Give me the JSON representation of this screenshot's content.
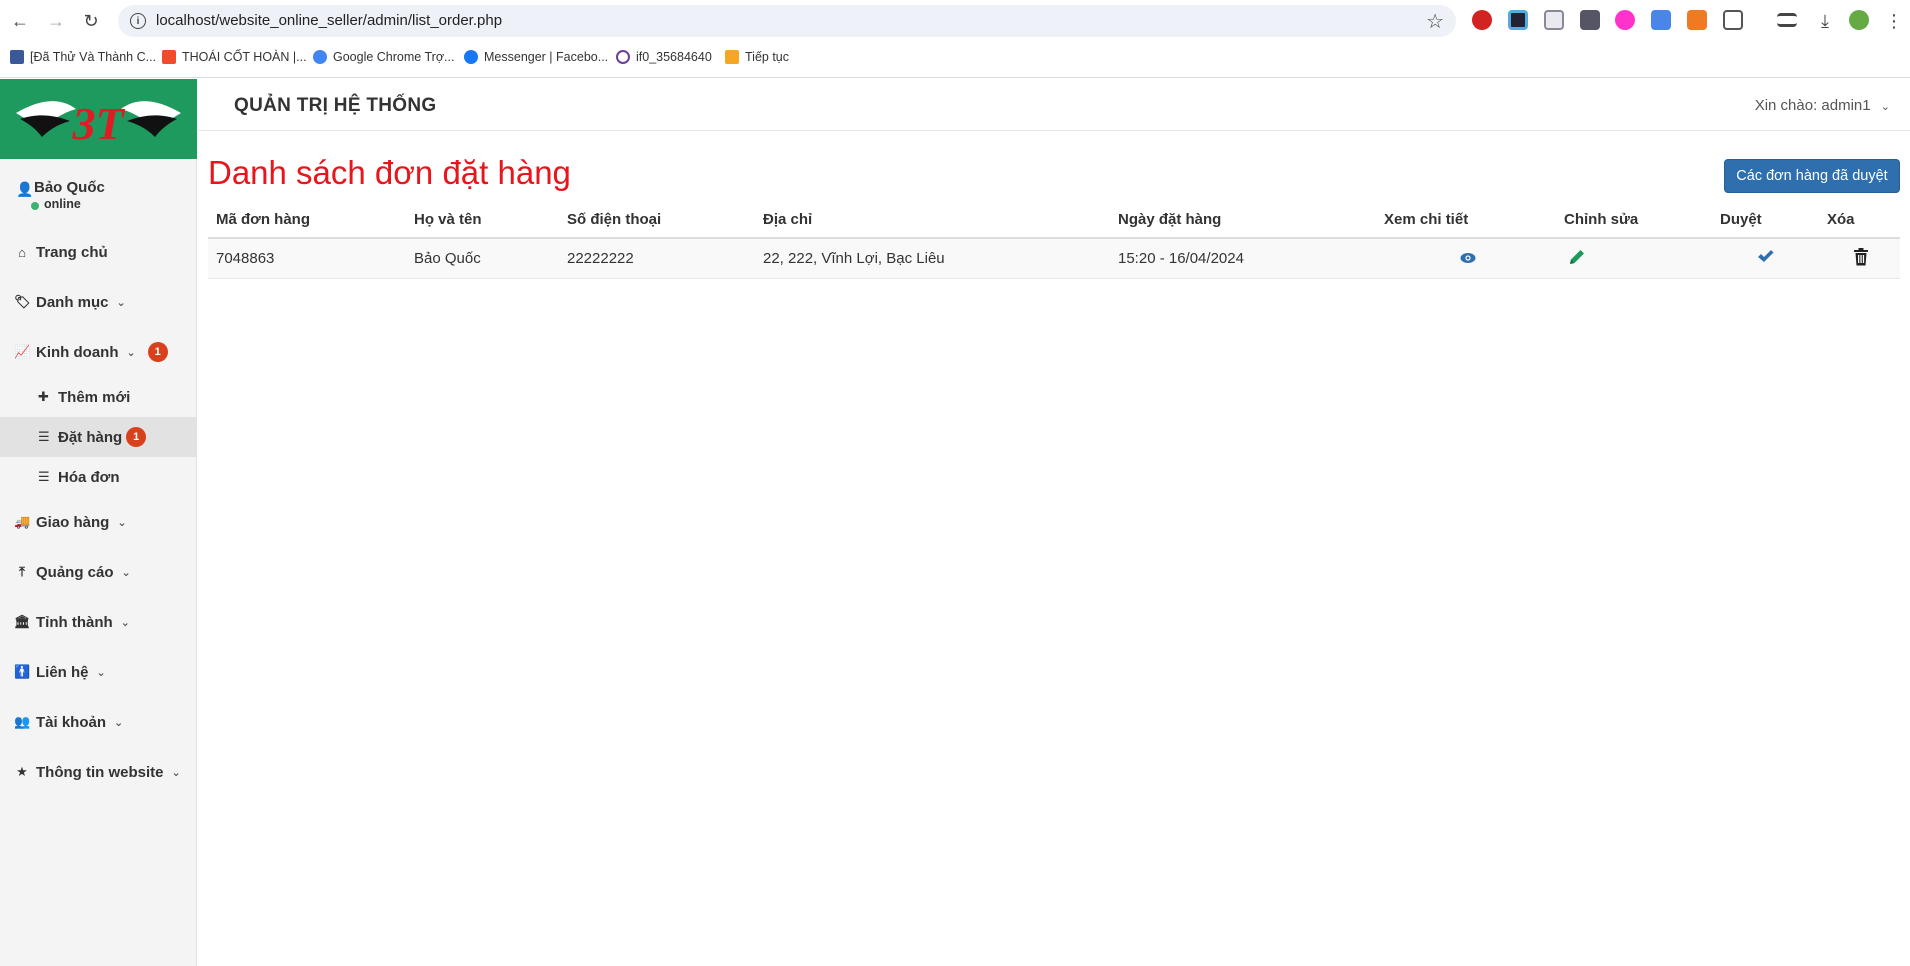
{
  "browser": {
    "url": "localhost/website_online_seller/admin/list_order.php",
    "bookmarks": [
      {
        "label": "[Đã Thử Và Thành C...",
        "color": "#3b5998"
      },
      {
        "label": "THOÁI CỐT HOÀN |...",
        "color": "#ee4d2d"
      },
      {
        "label": "Google Chrome Trợ...",
        "color": "#4285f4"
      },
      {
        "label": "Messenger | Facebo...",
        "color": "#1877f2"
      },
      {
        "label": "if0_35684640",
        "color": "#6b3fa0"
      },
      {
        "label": "Tiếp tục",
        "color": "#f5a623"
      }
    ]
  },
  "sidebar": {
    "logo_text": "3T",
    "user": {
      "name": "Bảo Quốc",
      "status": "online"
    },
    "menu": {
      "home": "Trang chủ",
      "category": "Danh mục",
      "business": {
        "label": "Kinh doanh",
        "badge": "1"
      },
      "add_new": "Thêm mới",
      "orders": {
        "label": "Đặt hàng",
        "badge": "1"
      },
      "invoices": "Hóa đơn",
      "shipping": "Giao hàng",
      "ads": "Quảng cáo",
      "provinces": "Tỉnh thành",
      "contact": "Liên hệ",
      "accounts": "Tài khoản",
      "website_info": "Thông tin website"
    }
  },
  "header": {
    "title": "QUẢN TRỊ HỆ THỐNG",
    "greeting": "Xin chào: admin1"
  },
  "main": {
    "page_title": "Danh sách đơn đặt hàng",
    "approved_button": "Các đơn hàng đã duyệt",
    "columns": [
      "Mã đơn hàng",
      "Họ và tên",
      "Số điện thoại",
      "Địa chỉ",
      "Ngày đặt hàng",
      "Xem chi tiết",
      "Chỉnh sửa",
      "Duyệt",
      "Xóa"
    ],
    "rows": [
      {
        "id": "7048863",
        "name": "Bảo Quốc",
        "phone": "22222222",
        "address": "22, 222, Vĩnh Lợi, Bạc Liêu",
        "date": "15:20 - 16/04/2024"
      }
    ],
    "colors": {
      "title": "#e8151b",
      "view": "#2f6fad",
      "edit": "#1e9a5e",
      "approve": "#2f6fad",
      "delete": "#222222"
    }
  }
}
